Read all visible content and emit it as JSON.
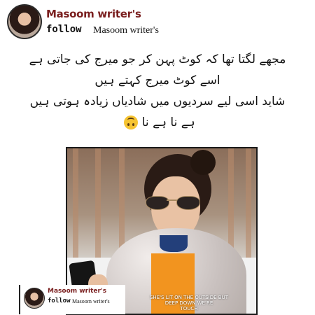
{
  "header": {
    "brand_name": "Masoom writer's",
    "follow_label": "follow",
    "follow_target": "Masoom writer's"
  },
  "poem": {
    "lines": [
      "مجھے لگتا تھا کہ کوٹ پہن کر جو میرج کی جاتی ہے",
      "اسے کوٹ میرج کہتے ہیں",
      "شاید اسی لیے سردیوں میں شادیاں زیادہ ہوتی ہیں",
      "ہے نا ہے نا"
    ],
    "emoji": "upside-down-face-icon"
  },
  "photo": {
    "caption_line1": "SHE'S LIT ON THE OUTSIDE BUT",
    "caption_line2": "DEEP DOWN WE'RE",
    "caption_line3": "TOUCH"
  },
  "watermark": {
    "brand_name": "Masoom writer's",
    "follow_label": "follow",
    "follow_target": "Masoom writer's"
  },
  "colors": {
    "brand": "#7a1f1f",
    "emoji": "#f6c431",
    "coat_orange": "#f2941f",
    "collar_blue": "#233f7a"
  }
}
